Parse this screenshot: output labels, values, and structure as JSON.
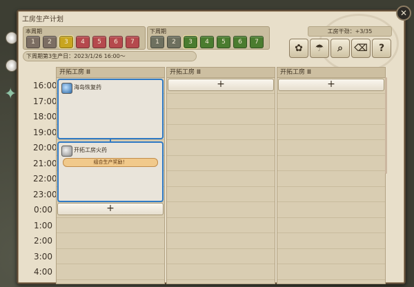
{
  "window": {
    "title": "工房生产计划",
    "close_glyph": "✕"
  },
  "current_period": {
    "label": "本周期",
    "days": [
      "1",
      "2",
      "3",
      "4",
      "5",
      "6",
      "7"
    ],
    "colors": [
      "#7c6e63",
      "#7c6e63",
      "#c8a51f",
      "#b5494d",
      "#b5494d",
      "#b5494d",
      "#b5494d"
    ],
    "active_index": 2
  },
  "next_period": {
    "label": "下周期",
    "days": [
      "1",
      "2",
      "3",
      "4",
      "5",
      "6",
      "7"
    ],
    "colors": [
      "#6e705f",
      "#6e705f",
      "#4a7c2f",
      "#4a7c2f",
      "#4a7c2f",
      "#4a7c2f",
      "#4a7c2f"
    ],
    "active_index": 2
  },
  "status": "下周期第3生产日：2023/1/26 16:00～",
  "points": "工房干劲：+3/35",
  "tools": [
    {
      "name": "plant-icon",
      "glyph": "✿"
    },
    {
      "name": "umbrella-icon",
      "glyph": "☂"
    },
    {
      "name": "magnify-icon",
      "glyph": "⌕"
    },
    {
      "name": "clear-icon",
      "glyph": "⌫"
    },
    {
      "name": "help-icon",
      "glyph": "?"
    }
  ],
  "hours": [
    "16:00",
    "17:00",
    "18:00",
    "19:00",
    "20:00",
    "21:00",
    "22:00",
    "23:00",
    "0:00",
    "1:00",
    "2:00",
    "3:00",
    "4:00"
  ],
  "columns": [
    {
      "header": "开拓工房 Ⅲ"
    },
    {
      "header": "开拓工房 Ⅲ"
    },
    {
      "header": "开拓工房 Ⅲ"
    }
  ],
  "blocks": [
    {
      "name": "海岛恢复药",
      "bonus": ""
    },
    {
      "name": "开拓工房火药",
      "bonus": "组合生产奖励！"
    }
  ],
  "add_glyph": "+"
}
